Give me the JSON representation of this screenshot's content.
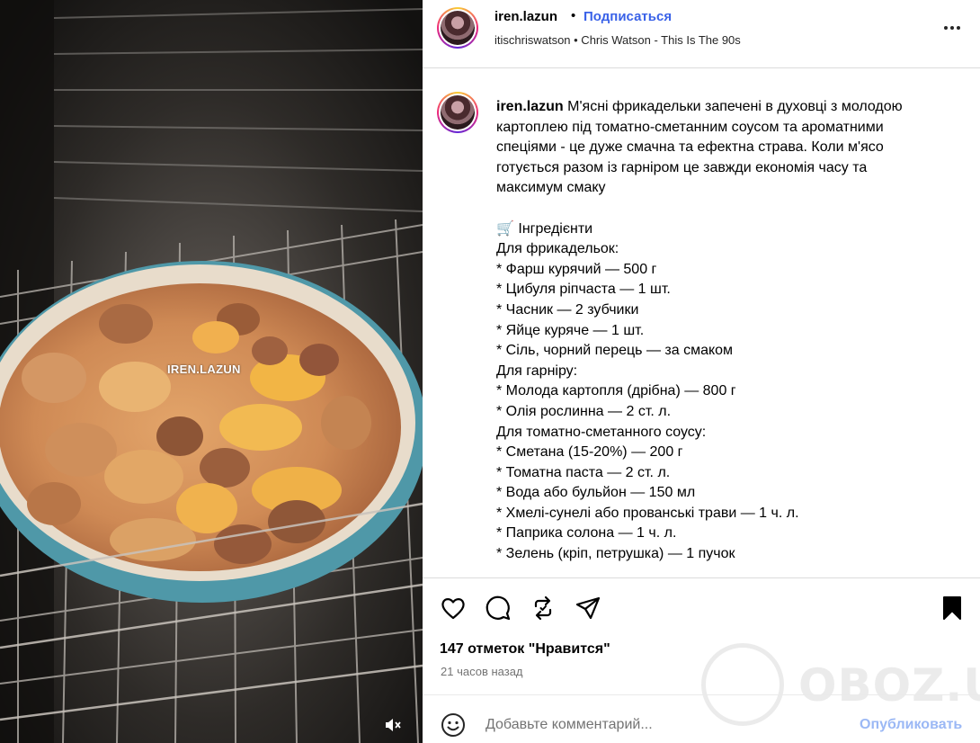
{
  "media": {
    "overlay_tag": "IREN.LAZUN",
    "mute_icon": "speaker-muted-icon"
  },
  "header": {
    "username": "iren.lazun",
    "separator": "•",
    "follow_label": "Подписаться",
    "audio": "itischriswatson • Chris Watson - This Is The 90s",
    "more_icon": "more-options-icon"
  },
  "caption": {
    "username": "iren.lazun",
    "intro_lines": [
      "М'ясні фрикадельки запечені в духовці з молодою",
      "картоплею під томатно-сметанним соусом та ароматними",
      "спеціями - це дуже смачна та ефектна страва. Коли м'ясо",
      "готується разом із гарніром це завжди економія часу та",
      "максимум смаку"
    ],
    "ingredients_heading": "Інгредієнти",
    "ingredients_icon": "shopping-cart-icon",
    "lines": [
      "Для фрикадельок:",
      "* Фарш курячий — 500 г",
      "* Цибуля ріпчаста — 1 шт.",
      "* Часник — 2 зубчики",
      "* Яйце куряче — 1 шт.",
      "* Сіль, чорний перець — за смаком",
      "Для гарніру:",
      "* Молода картопля (дрібна) — 800 г",
      "* Олія рослинна — 2 ст. л.",
      "Для томатно-сметанного соусу:",
      "* Сметана (15-20%) — 200 г",
      "* Томатна паста — 2 ст. л.",
      "* Вода або бульйон — 150 мл",
      "* Хмелі-сунелі або прованські трави — 1 ч. л.",
      "* Паприка солона — 1 ч. л.",
      "* Зелень (кріп, петрушка) — 1 пучок"
    ]
  },
  "actions": {
    "icons": [
      "heart-icon",
      "comment-icon",
      "repost-icon",
      "share-icon",
      "bookmark-icon"
    ],
    "likes": "147 отметок \"Нравится\"",
    "time": "21 часов назад"
  },
  "comment": {
    "placeholder": "Добавьте комментарий...",
    "publish_label": "Опубликовать",
    "emoji_icon": "emoji-smile-icon"
  },
  "watermark": {
    "text": "OBOZ.UA"
  },
  "colors": {
    "follow": "#3a62e8",
    "publish_disabled": "#9bb8f5",
    "secondary_text": "#737373",
    "divider": "#dbdbdb"
  }
}
